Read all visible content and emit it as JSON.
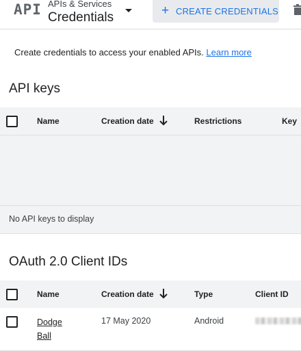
{
  "header": {
    "logo_text": "API",
    "service_label": "APIs & Services",
    "page_title": "Credentials",
    "create_button_label": "CREATE CREDENTIALS"
  },
  "intro": {
    "text": "Create credentials to access your enabled APIs.",
    "link": "Learn more"
  },
  "api_keys": {
    "title": "API keys",
    "columns": [
      "Name",
      "Creation date",
      "Restrictions",
      "Key"
    ],
    "empty_message": "No API keys to display"
  },
  "oauth": {
    "title": "OAuth 2.0 Client IDs",
    "columns": [
      "Name",
      "Creation date",
      "Type",
      "Client ID"
    ],
    "rows": [
      {
        "name_line1": "Dodge",
        "name_line2": "Ball",
        "creation_date": "17 May 2020",
        "type": "Android"
      }
    ]
  },
  "colors": {
    "accent": "#1a73e8",
    "header_bg": "#f1f3f4",
    "button_bg": "#e8eaed"
  }
}
